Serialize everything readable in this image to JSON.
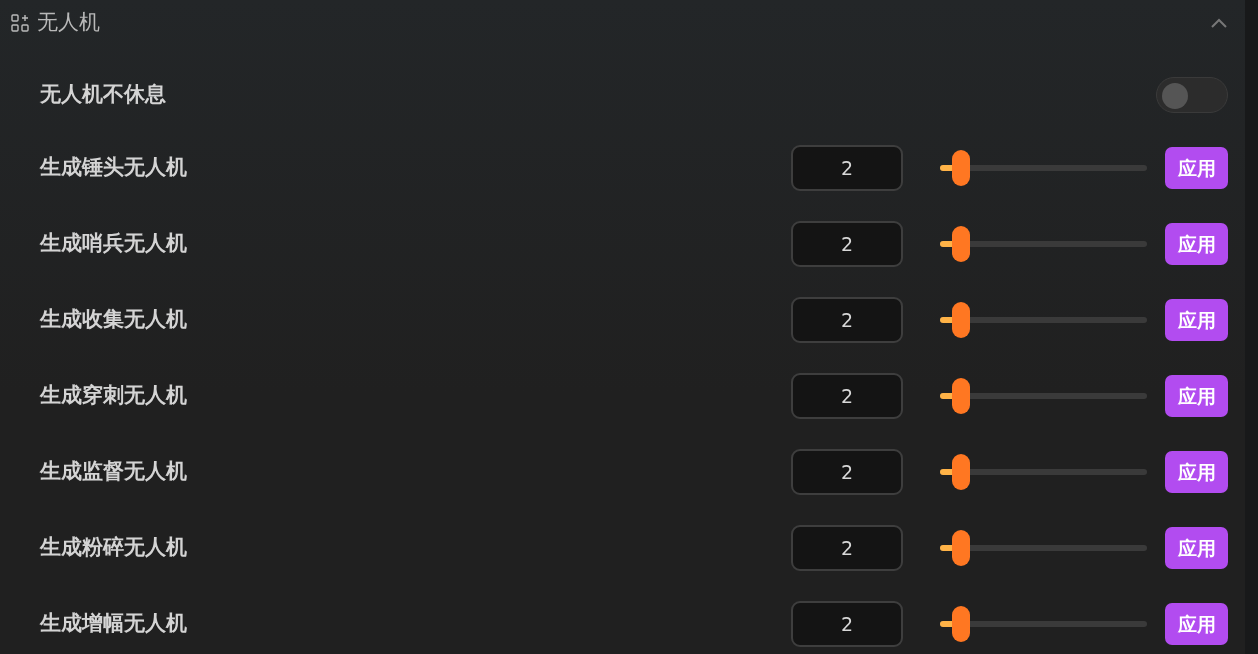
{
  "section": {
    "title": "无人机",
    "expanded": true
  },
  "toggle_row": {
    "label": "无人机不休息",
    "on": false
  },
  "rows": [
    {
      "label": "生成锤头无人机",
      "value": "2",
      "level": 0.1,
      "button": "应用"
    },
    {
      "label": "生成哨兵无人机",
      "value": "2",
      "level": 0.1,
      "button": "应用"
    },
    {
      "label": "生成收集无人机",
      "value": "2",
      "level": 0.1,
      "button": "应用"
    },
    {
      "label": "生成穿刺无人机",
      "value": "2",
      "level": 0.1,
      "button": "应用"
    },
    {
      "label": "生成监督无人机",
      "value": "2",
      "level": 0.1,
      "button": "应用"
    },
    {
      "label": "生成粉碎无人机",
      "value": "2",
      "level": 0.1,
      "button": "应用"
    },
    {
      "label": "生成增幅无人机",
      "value": "2",
      "level": 0.1,
      "button": "应用"
    }
  ]
}
